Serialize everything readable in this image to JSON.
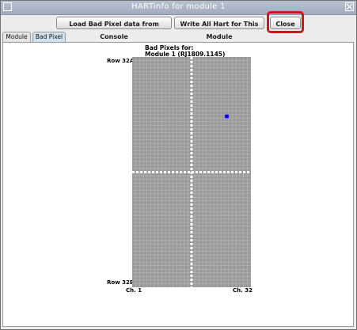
{
  "window": {
    "title": "HARTinfo for module 1"
  },
  "toolbar": {
    "load_label": "Load Bad Pixel data from Console",
    "write_label": "Write All Hart for This Module",
    "close_label": "Close"
  },
  "tabs": [
    {
      "label": "Module",
      "active": false
    },
    {
      "label": "Bad Pixel",
      "active": true
    }
  ],
  "panel": {
    "header_line1": "Bad Pixels for:",
    "header_line2": "Module 1 (RJ1809.1145)",
    "row_top": "Row 32A",
    "row_bottom": "Row 32B",
    "col_left": "Ch. 1",
    "col_right": "Ch. 32"
  },
  "grid": {
    "columns": 32,
    "rows": 64,
    "cell_color": "#9a9a9a",
    "line_color": "#b8b8b8",
    "bad_pixels": [
      {
        "row": 16,
        "col": 25
      }
    ],
    "bad_color": "#0000ee"
  }
}
